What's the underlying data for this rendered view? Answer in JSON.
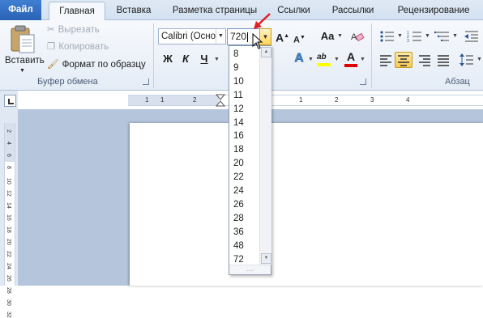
{
  "tabs": {
    "file": "Файл",
    "home": "Главная",
    "insert": "Вставка",
    "layout": "Разметка страницы",
    "references": "Ссылки",
    "mailings": "Рассылки",
    "review": "Рецензирование"
  },
  "clipboard": {
    "paste": "Вставить",
    "cut": "Вырезать",
    "copy": "Копировать",
    "format_painter": "Формат по образцу",
    "group_label": "Буфер обмена"
  },
  "font": {
    "font_name": "Calibri (Осно",
    "font_size": "720",
    "grow": "A",
    "shrink": "A",
    "change_case": "Aa",
    "bold": "Ж",
    "italic": "К",
    "underline": "Ч",
    "text_effects": "A",
    "highlight": "ab",
    "font_color": "A"
  },
  "paragraph": {
    "group_label": "Абзац"
  },
  "size_dropdown": {
    "items": [
      "8",
      "9",
      "10",
      "11",
      "12",
      "14",
      "16",
      "18",
      "20",
      "22",
      "24",
      "26",
      "28",
      "36",
      "48",
      "72"
    ],
    "grip": "....",
    "scroll_up": "▲",
    "scroll_down": "▼"
  },
  "ruler": {
    "h_left": "1",
    "h_marks": [
      "1",
      "2",
      "1",
      "2",
      "3",
      "4"
    ],
    "v_marks": [
      "2",
      "4",
      "6",
      "8",
      "10",
      "12",
      "14",
      "16",
      "18",
      "20",
      "22",
      "24",
      "26",
      "28",
      "30",
      "32"
    ]
  },
  "colors": {
    "accent": "#2a62b5",
    "pointer_arrow": "#e02020",
    "highlight_yellow": "#ffff00",
    "font_red": "#e00000"
  }
}
